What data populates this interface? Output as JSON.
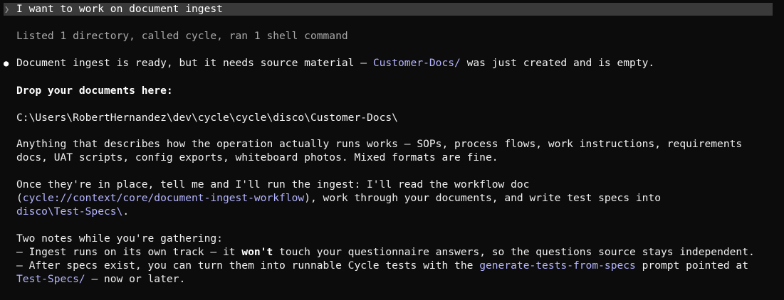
{
  "prompt": {
    "chevron": "❯",
    "text": "I want to work on document ingest"
  },
  "activity": "Listed 1 directory, called cycle, ran 1 shell command",
  "response": {
    "bullet": "●",
    "intro_before": "Document ingest is ready, but it needs source material — ",
    "intro_link": "Customer-Docs/",
    "intro_after": " was just created and is empty.",
    "drop_heading": "Drop your documents here:",
    "path": "C:\\Users\\RobertHernandez\\dev\\cycle\\cycle\\disco\\Customer-Docs\\",
    "describes_line1": "Anything that describes how the operation actually runs works — SOPs, process flows, work instructions, requirements",
    "describes_line2": "docs, UAT scripts, config exports, whiteboard photos. Mixed formats are fine.",
    "once_line1": "Once they're in place, tell me and I'll run the ingest: I'll read the workflow doc",
    "once_line2_open": "(",
    "once_line2_link": "cycle://context/core/document-ingest-workflow",
    "once_line2_rest": "), work through your documents, and write test specs into",
    "once_line3_link": "disco\\Test-Specs\\",
    "once_line3_rest": ".",
    "notes_heading": "Two notes while you're gathering:",
    "note1_before": "— Ingest runs on its own track — it ",
    "note1_bold": "won't",
    "note1_after": " touch your questionnaire answers, so the questions source stays independent.",
    "note2_before": "— After specs exist, you can turn them into runnable Cycle tests with the ",
    "note2_link": "generate-tests-from-specs",
    "note2_after": " prompt pointed at",
    "note3_link": "Test-Specs/",
    "note3_after": " — now or later."
  }
}
